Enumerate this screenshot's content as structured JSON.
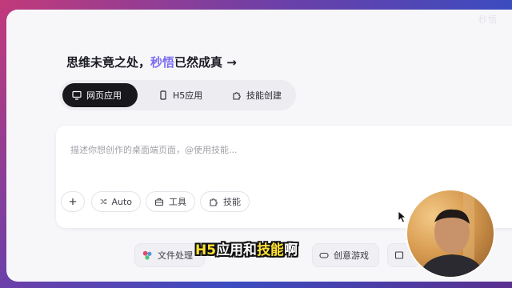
{
  "watermark": "秒悟",
  "headline": {
    "prefix": "思维未竟之处，",
    "accent": "秒悟",
    "suffix": "已然成真 →"
  },
  "mode_tabs": [
    {
      "label": "网页应用",
      "icon": "monitor-icon",
      "active": true
    },
    {
      "label": "H5应用",
      "icon": "mobile-icon",
      "active": false
    },
    {
      "label": "技能创建",
      "icon": "puzzle-icon",
      "active": false
    }
  ],
  "composer": {
    "placeholder": "描述你想创作的桌面端页面，@使用技能...",
    "chips": [
      {
        "label": "",
        "icon": "plus-icon"
      },
      {
        "label": "Auto",
        "icon": "shuffle-icon"
      },
      {
        "label": "工具",
        "icon": "toolbox-icon"
      },
      {
        "label": "技能",
        "icon": "puzzle-icon"
      }
    ]
  },
  "bottom_cards": [
    {
      "label": "文件处理",
      "icon": "app-logo-icon"
    },
    {
      "label": "创意游戏",
      "icon": "gamepad-icon"
    },
    {
      "label": "",
      "icon": "window-icon"
    }
  ],
  "subtitle": {
    "part1": "H5",
    "part2": "应用和",
    "part3": "技能",
    "part4": "啊"
  },
  "colors": {
    "accent": "#7b6cf0",
    "active_tab": "#17171c",
    "subtitle_highlight": "#ffe135"
  }
}
